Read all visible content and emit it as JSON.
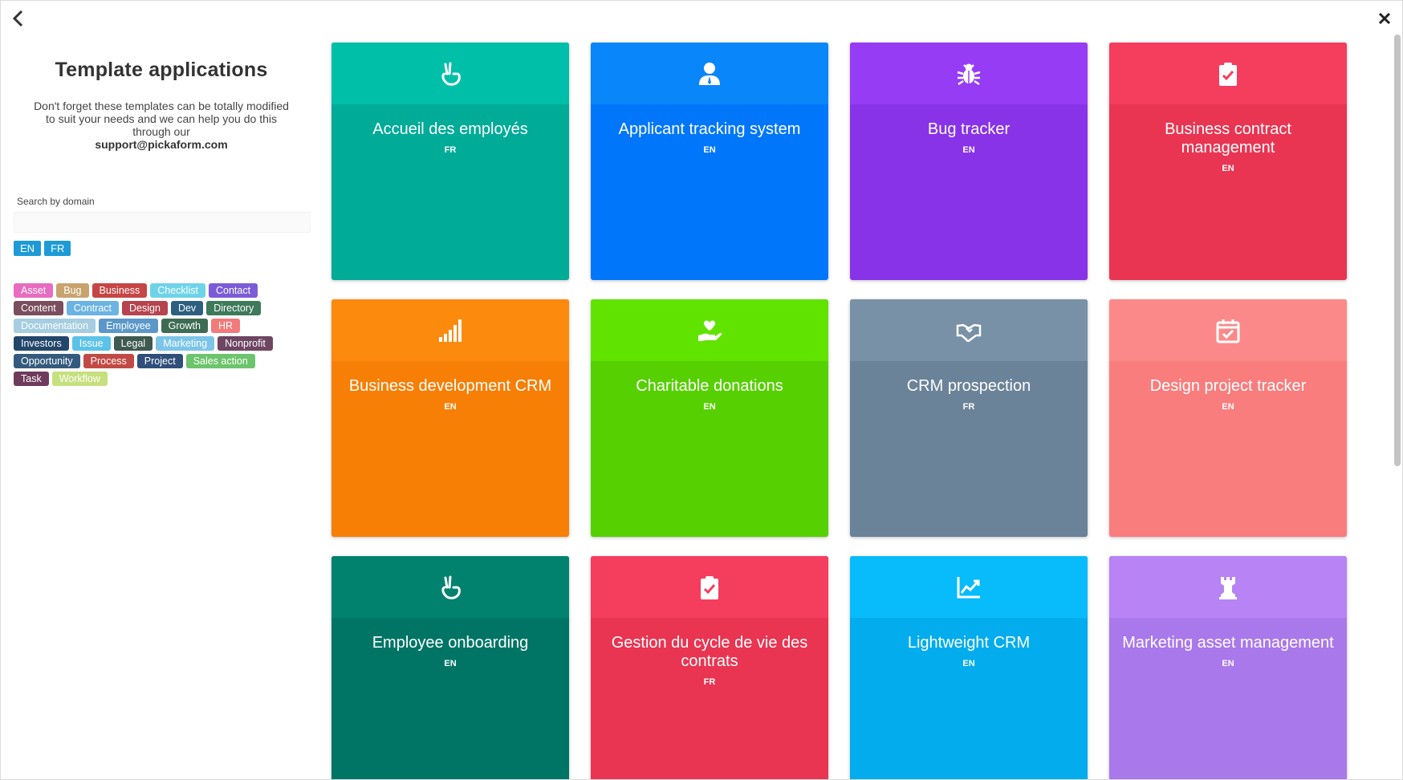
{
  "sidebar": {
    "title": "Template applications",
    "description": "Don't forget these templates can be totally modified to suit your needs and we can help you do this through our",
    "email": "support@pickaform.com",
    "search_label": "Search by domain",
    "search_value": "",
    "languages": [
      "EN",
      "FR"
    ],
    "tags": [
      {
        "label": "Asset",
        "color": "#e86cbf"
      },
      {
        "label": "Bug",
        "color": "#c8a36e"
      },
      {
        "label": "Business",
        "color": "#c64545"
      },
      {
        "label": "Checklist",
        "color": "#6ed3e8"
      },
      {
        "label": "Contact",
        "color": "#7c5cd6"
      },
      {
        "label": "Content",
        "color": "#7b4e5e"
      },
      {
        "label": "Contract",
        "color": "#6ab3e3"
      },
      {
        "label": "Design",
        "color": "#b5444f"
      },
      {
        "label": "Dev",
        "color": "#2c5f80"
      },
      {
        "label": "Directory",
        "color": "#3d7a5a"
      },
      {
        "label": "Documentation",
        "color": "#a6cde0"
      },
      {
        "label": "Employee",
        "color": "#5b98c9"
      },
      {
        "label": "Growth",
        "color": "#3e6b54"
      },
      {
        "label": "HR",
        "color": "#f27a7a"
      },
      {
        "label": "Investors",
        "color": "#23466b"
      },
      {
        "label": "Issue",
        "color": "#5cc2e8"
      },
      {
        "label": "Legal",
        "color": "#3f5a50"
      },
      {
        "label": "Marketing",
        "color": "#7cc5e8"
      },
      {
        "label": "Nonprofit",
        "color": "#6e4562"
      },
      {
        "label": "Opportunity",
        "color": "#345b7d"
      },
      {
        "label": "Process",
        "color": "#c24a45"
      },
      {
        "label": "Project",
        "color": "#2f4e7a"
      },
      {
        "label": "Sales action",
        "color": "#6cc46c"
      },
      {
        "label": "Task",
        "color": "#6e3b5c"
      },
      {
        "label": "Workflow",
        "color": "#c6e07e"
      }
    ]
  },
  "cards": [
    {
      "title": "Accueil des employés",
      "lang": "FR",
      "icon": "hand-peace-icon",
      "head": "#00bfa8",
      "body": "#00ab98"
    },
    {
      "title": "Applicant tracking system",
      "lang": "EN",
      "icon": "user-tie-icon",
      "head": "#0a86fb",
      "body": "#0077fa"
    },
    {
      "title": "Bug tracker",
      "lang": "EN",
      "icon": "bug-icon",
      "head": "#963cf5",
      "body": "#8833e8"
    },
    {
      "title": "Business contract management",
      "lang": "EN",
      "icon": "clipboard-check-icon",
      "head": "#f53d5e",
      "body": "#e93552"
    },
    {
      "title": "Business development CRM",
      "lang": "EN",
      "icon": "signal-icon",
      "head": "#fc8b0d",
      "body": "#f77f06"
    },
    {
      "title": "Charitable donations",
      "lang": "EN",
      "icon": "hand-holding-heart-icon",
      "head": "#61e300",
      "body": "#56d000"
    },
    {
      "title": "CRM prospection",
      "lang": "FR",
      "icon": "handshake-icon",
      "head": "#7891a6",
      "body": "#6b8399"
    },
    {
      "title": "Design project tracker",
      "lang": "EN",
      "icon": "calendar-check-icon",
      "head": "#fc8989",
      "body": "#f97d7d"
    },
    {
      "title": "Employee onboarding",
      "lang": "EN",
      "icon": "hand-peace-icon",
      "head": "#00826e",
      "body": "#007565"
    },
    {
      "title": "Gestion du cycle de vie des contrats",
      "lang": "FR",
      "icon": "clipboard-check-icon",
      "head": "#f53d5e",
      "body": "#e93552"
    },
    {
      "title": "Lightweight CRM",
      "lang": "EN",
      "icon": "chart-line-icon",
      "head": "#08bbfa",
      "body": "#02aced"
    },
    {
      "title": "Marketing asset management",
      "lang": "EN",
      "icon": "chess-rook-icon",
      "head": "#b883f5",
      "body": "#a978ea"
    }
  ]
}
